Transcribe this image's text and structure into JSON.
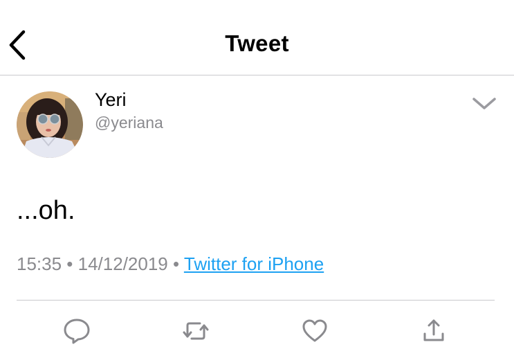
{
  "header": {
    "title": "Tweet",
    "back_icon": "chevron-left-icon"
  },
  "tweet": {
    "author": {
      "display_name": "Yeri",
      "handle": "@yeriana"
    },
    "text": "...oh.",
    "time": "15:35",
    "separator": " • ",
    "date": "14/12/2019",
    "source": "Twitter for iPhone"
  },
  "actions": {
    "reply_icon": "reply-icon",
    "retweet_icon": "retweet-icon",
    "like_icon": "heart-icon",
    "share_icon": "share-icon"
  },
  "colors": {
    "link": "#1da1f2",
    "secondary_text": "#8a8a8e",
    "icon": "#8a8a8e",
    "divider": "#c8c8cc"
  }
}
